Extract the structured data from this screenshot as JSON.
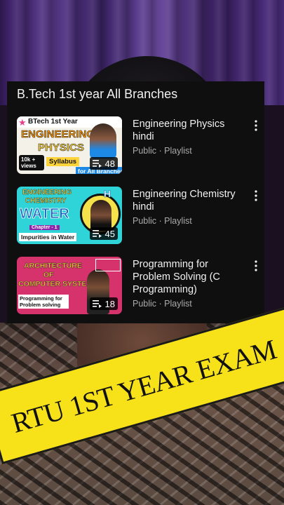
{
  "panel": {
    "title": "B.Tech 1st year All Branches"
  },
  "playlists": [
    {
      "title": "Engineering Physics hindi",
      "meta": "Public · Playlist",
      "count": "48",
      "thumb": {
        "top_label": "BTech 1st Year",
        "line1": "ENGINEERING",
        "line2": "PHYSICS",
        "badge": "10k + views",
        "tag": "Syllabus",
        "footer": "for All Branches",
        "bg": "#f4f1e8",
        "accent": "#ff9800"
      }
    },
    {
      "title": "Engineering Chemistry hindi",
      "meta": "Public · Playlist",
      "count": "45",
      "thumb": {
        "line1": "ENGINEERING",
        "line2": "CHEMISTRY",
        "big": "WATER",
        "chapter": "Chapter - 1",
        "tag": "Impurities in Water",
        "corner": "H",
        "bg": "#2fd4d9",
        "accent": "#f5e24a"
      }
    },
    {
      "title": "Programming for Problem Solving (C Programming)",
      "meta": "Public · Playlist",
      "count": "18",
      "thumb": {
        "line1": "ARCHITECTURE",
        "line2": "OF",
        "line3": "COMPUTER SYSTEM",
        "tag": "Programming for Problem solving",
        "bg": "#d6336c",
        "accent": "#ffd43b"
      }
    }
  ],
  "banner": {
    "text": "RTU 1ST YEAR EXAM",
    "color": "#f7e21a"
  }
}
